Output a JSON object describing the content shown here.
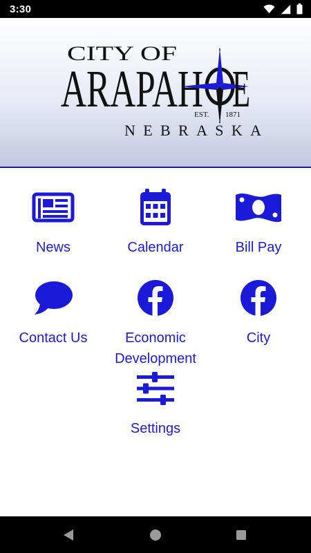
{
  "status_bar": {
    "time": "3:30",
    "icons": [
      "wifi-icon",
      "signal-icon",
      "battery-icon"
    ]
  },
  "header": {
    "logo": {
      "line1": "CITY OF",
      "line2_part1": "ARAPAH",
      "line2_part2": "E",
      "est_label": "EST.",
      "est_year": "1871",
      "line3": "NEBRASKA"
    }
  },
  "tiles": [
    {
      "label": "News",
      "icon": "newspaper-icon"
    },
    {
      "label": "Calendar",
      "icon": "calendar-icon"
    },
    {
      "label": "Bill Pay",
      "icon": "money-bill-icon"
    },
    {
      "label": "Contact Us",
      "icon": "chat-bubble-icon"
    },
    {
      "label_line1": "Economic",
      "label_line2": "Development",
      "icon": "facebook-icon"
    },
    {
      "label": "City",
      "icon": "facebook-icon"
    },
    {
      "label": "Settings",
      "icon": "sliders-icon"
    }
  ],
  "nav_bar": {
    "buttons": [
      "back-icon",
      "home-icon",
      "recents-icon"
    ]
  },
  "colors": {
    "accent": "#1a1ad8",
    "header_line": "#1d1fa8",
    "logo_text": "#111111"
  }
}
